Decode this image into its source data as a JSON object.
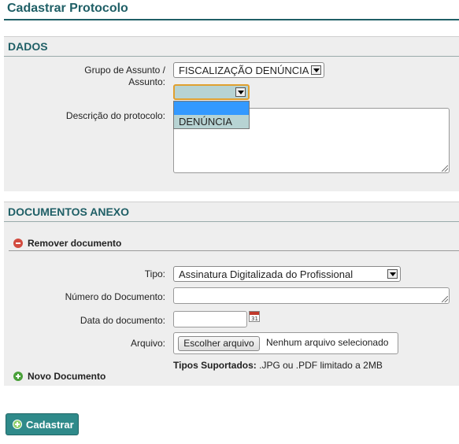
{
  "page": {
    "title": "Cadastrar Protocolo"
  },
  "dados": {
    "heading": "DADOS",
    "grupo_label": "Grupo de Assunto /",
    "assunto_label": "Assunto:",
    "grupo_value": "FISCALIZAÇÃO DENÚNCIA",
    "assunto_value": "",
    "assunto_options": [
      "",
      "DENÚNCIA"
    ],
    "descricao_label": "Descrição do protocolo:"
  },
  "anexo": {
    "heading": "DOCUMENTOS ANEXO",
    "remover": "Remover documento",
    "tipo_label": "Tipo:",
    "tipo_value": "Assinatura Digitalizada do Profissional",
    "numero_label": "Número do Documento:",
    "data_label": "Data do documento:",
    "arquivo_label": "Arquivo:",
    "file_button": "Escolher arquivo",
    "file_status": "Nenhum arquivo selecionado",
    "tipos_label": "Tipos Suportados:",
    "tipos_text": " .JPG ou .PDF limitado a 2MB",
    "novo": "Novo Documento"
  },
  "actions": {
    "submit": "Cadastrar"
  },
  "colors": {
    "accent": "#1f5f66",
    "button": "#2f8a8a",
    "remove": "#d24b3f",
    "add": "#4aa03a",
    "highlight": "#3399ff"
  }
}
